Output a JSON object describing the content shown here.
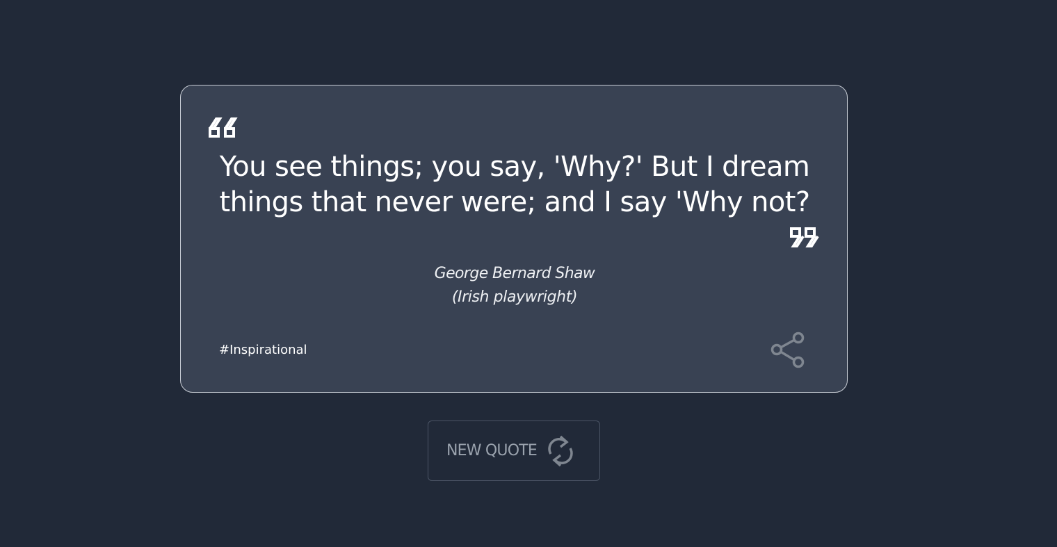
{
  "quote": {
    "text": "You see things; you say, 'Why?' But I dream things that never were; and I say 'Why not?",
    "author": "George Bernard Shaw",
    "author_description": "(Irish playwright)",
    "tag": "#Inspirational"
  },
  "icons": {
    "open_quote": "left-quote-icon",
    "close_quote": "right-quote-icon",
    "share": "share-icon",
    "refresh": "refresh-icon"
  },
  "button": {
    "new_quote_label": "NEW QUOTE"
  },
  "colors": {
    "background": "#212938",
    "card": "#394253",
    "card_border": "#c9ced6",
    "text": "#ffffff",
    "muted": "#9aa2ad",
    "icon_gray": "#7f8690"
  }
}
